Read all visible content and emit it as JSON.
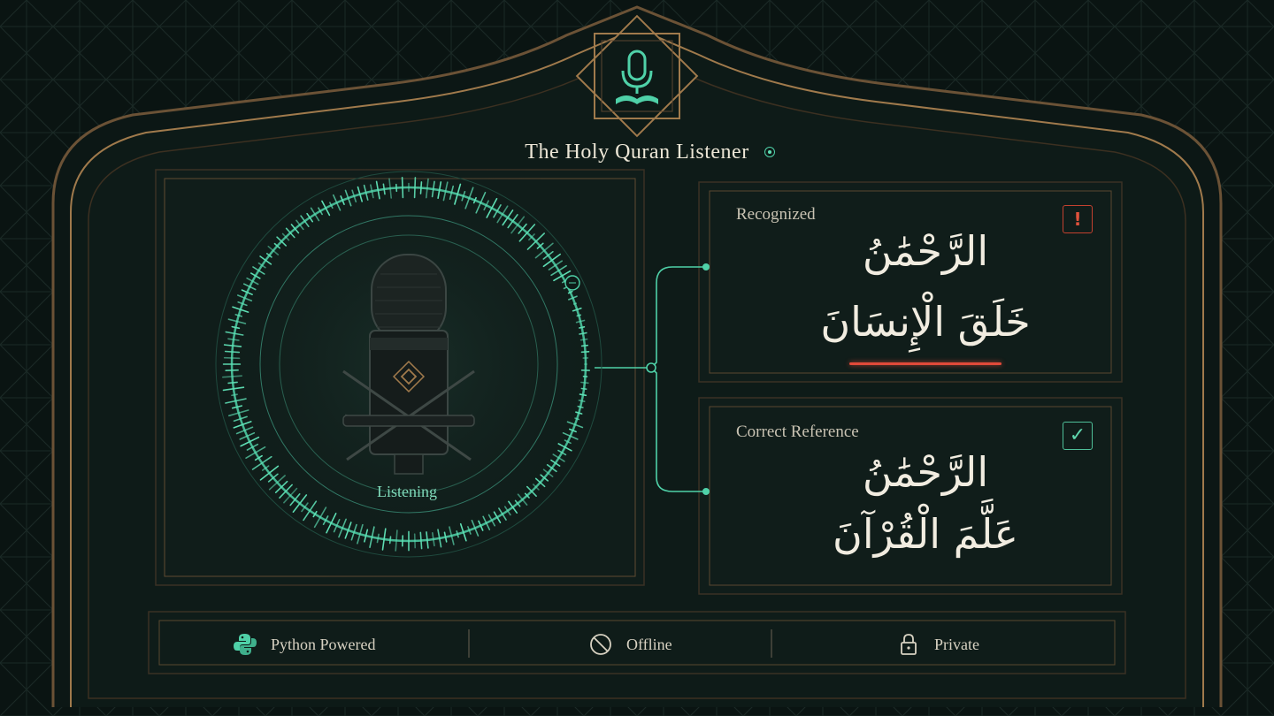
{
  "app": {
    "title": "The Holy Quran Listener"
  },
  "mic_panel": {
    "status_label": "Listening"
  },
  "recognized": {
    "label": "Recognized",
    "line1": "الرَّحْمَٰنُ",
    "line2": "خَلَقَ الْإِنسَانَ",
    "badge": "!"
  },
  "reference": {
    "label": "Correct Reference",
    "line1": "الرَّحْمَٰنُ",
    "line2": "عَلَّمَ الْقُرْآنَ",
    "badge": "✓"
  },
  "footer": {
    "items": [
      {
        "label": "Python Powered",
        "icon": "python-icon"
      },
      {
        "label": "Offline",
        "icon": "no-signal-icon"
      },
      {
        "label": "Private",
        "icon": "lock-icon"
      }
    ]
  },
  "colors": {
    "accent": "#4fd1a8",
    "error": "#e24a3a",
    "frame": "#8a6a45",
    "background": "#0b1513"
  }
}
